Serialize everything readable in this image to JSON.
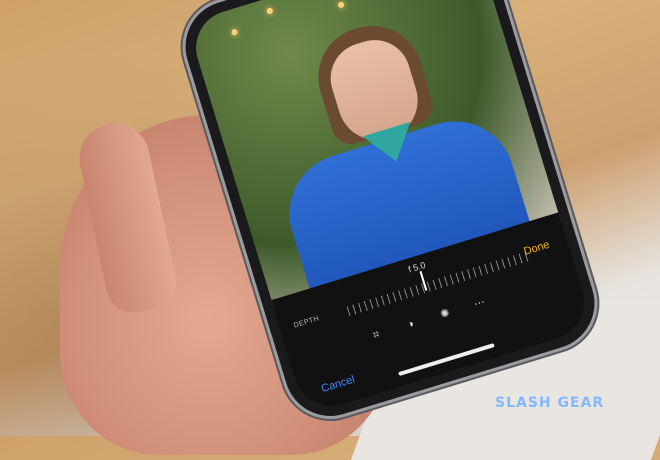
{
  "editor": {
    "aperture": "f 5.0",
    "depth_label": "DEPTH",
    "done_label": "Done",
    "cancel_label": "Cancel"
  },
  "watermark": {
    "text": "SLASH GEAR"
  },
  "colors": {
    "done": "#f2b01e",
    "cancel": "#3f8cff",
    "jacket": "#2f6fd6"
  },
  "icons": [
    "crop-icon",
    "filters-icon",
    "adjust-icon",
    "more-icon"
  ]
}
